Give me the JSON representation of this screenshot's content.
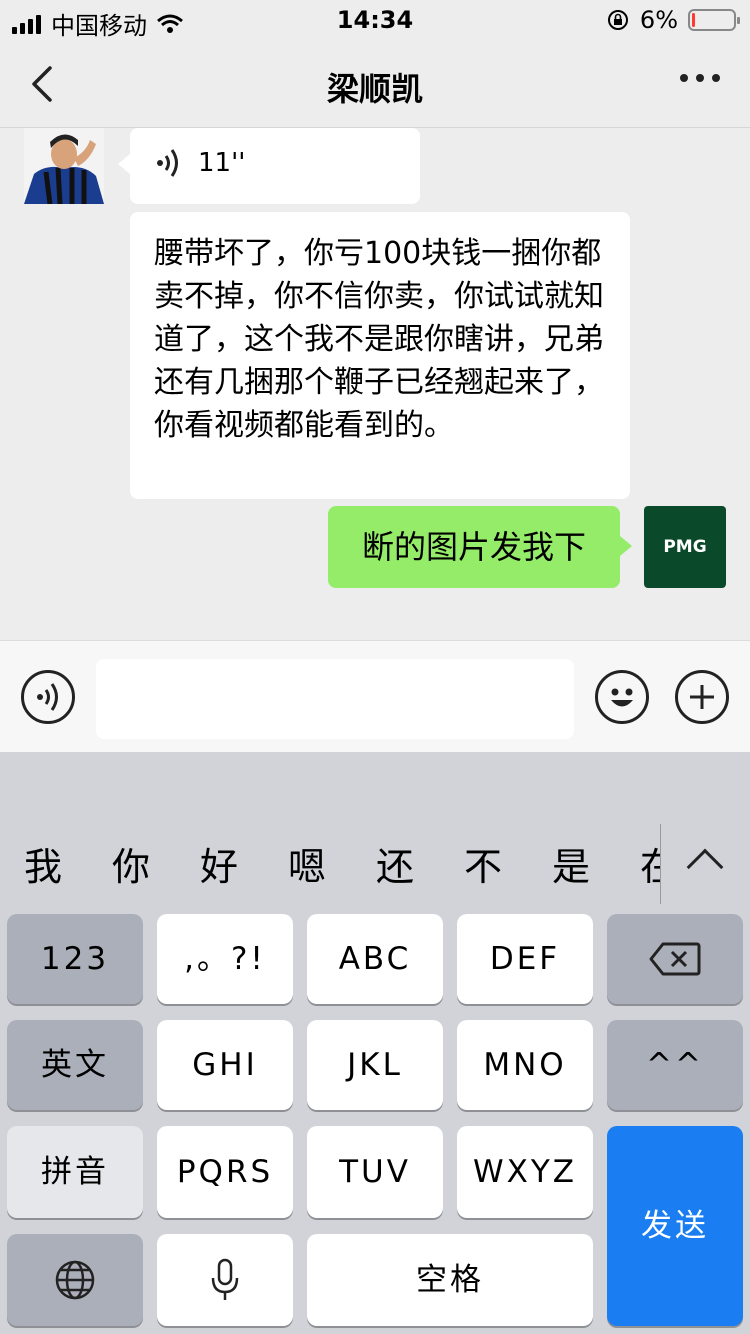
{
  "status_bar": {
    "carrier": "中国移动",
    "time": "14:34",
    "battery": "6%",
    "battery_level": 0.06
  },
  "nav": {
    "title": "梁顺凯"
  },
  "messages": {
    "voice": {
      "duration": "11''"
    },
    "text": "腰带坏了，你亏100块钱一捆你都卖不掉，你不信你卖，你试试就知道了，这个我不是跟你瞎讲，兄弟还有几捆那个鞭子已经翘起来了，你看视频都能看到的。",
    "sent": "断的图片发我下",
    "sent_avatar_label": "PMG"
  },
  "candidates": [
    "我",
    "你",
    "好",
    "嗯",
    "还",
    "不",
    "是",
    "在"
  ],
  "keyboard": {
    "row1": [
      "123",
      ",。?!",
      "ABC",
      "DEF"
    ],
    "row2": [
      "英文",
      "GHI",
      "JKL",
      "MNO",
      "^^"
    ],
    "row3": [
      "拼音",
      "PQRS",
      "TUV",
      "WXYZ"
    ],
    "space": "空格",
    "send": "发送"
  },
  "colors": {
    "sent_bubble": "#95ec69",
    "send_key": "#1a7ef2"
  }
}
